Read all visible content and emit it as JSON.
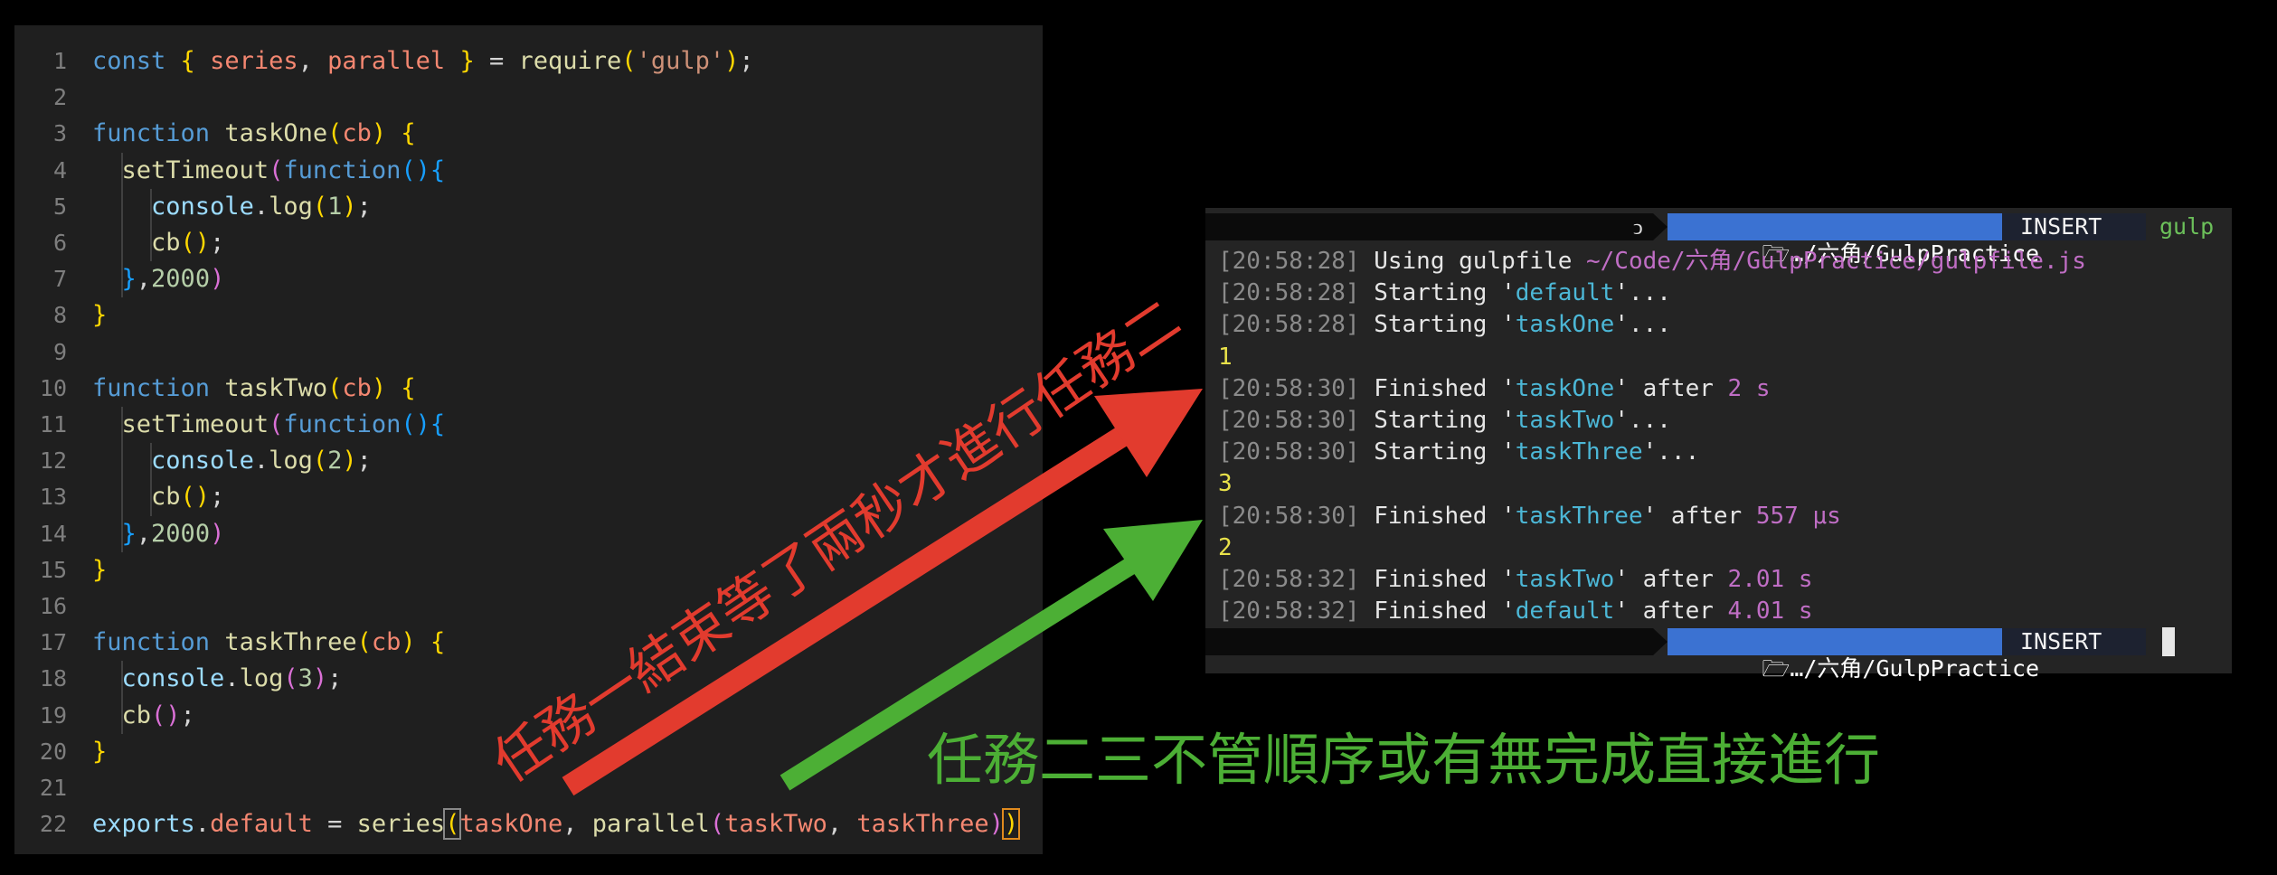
{
  "editor": {
    "lines": [
      {
        "n": "1",
        "html": "<span class='kw2'>const</span> <span class='p1'>{</span> <span class='var'>series</span>, <span class='var'>parallel</span> <span class='p1'>}</span> = <span class='fn'>require</span><span class='p1'>(</span><span class='str'>'gulp'</span><span class='p1'>)</span>;"
      },
      {
        "n": "2",
        "html": ""
      },
      {
        "n": "3",
        "html": "<span class='kw2'>function</span> <span class='fn'>taskOne</span><span class='p1'>(</span><span class='var'>cb</span><span class='p1'>)</span> <span class='p1'>{</span>"
      },
      {
        "n": "4",
        "html": "  <span class='fn'>setTimeout</span><span class='p2'>(</span><span class='kw2'>function</span><span class='p3'>(){</span>"
      },
      {
        "n": "5",
        "html": "    <span class='obj'>console</span>.<span class='fn'>log</span><span class='p1'>(</span><span class='num'>1</span><span class='p1'>)</span>;"
      },
      {
        "n": "6",
        "html": "    <span class='fn'>cb</span><span class='p1'>()</span>;"
      },
      {
        "n": "7",
        "html": "  <span class='p3'>}</span>,<span class='num'>2000</span><span class='p2'>)</span>"
      },
      {
        "n": "8",
        "html": "<span class='p1'>}</span>"
      },
      {
        "n": "9",
        "html": ""
      },
      {
        "n": "10",
        "html": "<span class='kw2'>function</span> <span class='fn'>taskTwo</span><span class='p1'>(</span><span class='var'>cb</span><span class='p1'>)</span> <span class='p1'>{</span>"
      },
      {
        "n": "11",
        "html": "  <span class='fn'>setTimeout</span><span class='p2'>(</span><span class='kw2'>function</span><span class='p3'>(){</span>"
      },
      {
        "n": "12",
        "html": "    <span class='obj'>console</span>.<span class='fn'>log</span><span class='p1'>(</span><span class='num'>2</span><span class='p1'>)</span>;"
      },
      {
        "n": "13",
        "html": "    <span class='fn'>cb</span><span class='p1'>()</span>;"
      },
      {
        "n": "14",
        "html": "  <span class='p3'>}</span>,<span class='num'>2000</span><span class='p2'>)</span>"
      },
      {
        "n": "15",
        "html": "<span class='p1'>}</span>"
      },
      {
        "n": "16",
        "html": ""
      },
      {
        "n": "17",
        "html": "<span class='kw2'>function</span> <span class='fn'>taskThree</span><span class='p1'>(</span><span class='var'>cb</span><span class='p1'>)</span> <span class='p1'>{</span>"
      },
      {
        "n": "18",
        "html": "  <span class='obj'>console</span>.<span class='fn'>log</span><span class='p2'>(</span><span class='num'>3</span><span class='p2'>)</span>;"
      },
      {
        "n": "19",
        "html": "  <span class='fn'>cb</span><span class='p2'>()</span>;"
      },
      {
        "n": "20",
        "html": "<span class='p1'>}</span>"
      },
      {
        "n": "21",
        "html": ""
      },
      {
        "n": "22",
        "html": "<span class='obj'>exports</span>.<span class='var'>default</span> = <span class='fn'>series</span><span class='p1' style='outline:2px solid #888;'>(</span><span class='var'>taskOne</span>, <span class='fn'>parallel</span><span class='p2'>(</span><span class='var'>taskTwo</span>, <span class='var'>taskThree</span><span class='p2'>)</span><span class='p1' style='outline:2px solid #e08a1e;'>)</span>"
      }
    ]
  },
  "terminal": {
    "top_prompt": {
      "path": "…/六角/GulpPractice",
      "mode": "INSERT",
      "cmd": "gulp"
    },
    "bottom_prompt": {
      "path": "…/六角/GulpPractice",
      "mode": "INSERT"
    },
    "lines": [
      {
        "html": "<span class='ts'>[20:58:28]</span> Using gulpfile <span class='path'>~/Code/六角/GulpPractice/gulpfile.js</span>"
      },
      {
        "html": "<span class='ts'>[20:58:28]</span> Starting '<span class='task'>default</span>'..."
      },
      {
        "html": "<span class='ts'>[20:58:28]</span> Starting '<span class='task'>taskOne</span>'..."
      },
      {
        "html": "<span class='num-out'>1</span>"
      },
      {
        "html": "<span class='ts'>[20:58:30]</span> Finished '<span class='task'>taskOne</span>' after <span class='dur'>2 s</span>"
      },
      {
        "html": "<span class='ts'>[20:58:30]</span> Starting '<span class='task'>taskTwo</span>'..."
      },
      {
        "html": "<span class='ts'>[20:58:30]</span> Starting '<span class='task'>taskThree</span>'..."
      },
      {
        "html": "<span class='num-out'>3</span>"
      },
      {
        "html": "<span class='ts'>[20:58:30]</span> Finished '<span class='task'>taskThree</span>' after <span class='dur'>557 μs</span>"
      },
      {
        "html": "<span class='num-out'>2</span>"
      },
      {
        "html": "<span class='ts'>[20:58:32]</span> Finished '<span class='task'>taskTwo</span>' after <span class='dur'>2.01 s</span>"
      },
      {
        "html": "<span class='ts'>[20:58:32]</span> Finished '<span class='task'>default</span>' after <span class='dur'>4.01 s</span>"
      }
    ]
  },
  "annotations": {
    "red_text": "任務一結束等了兩秒才進行任務二",
    "green_text": "任務二三不管順序或有無完成直接進行",
    "red_color": "#e23b2e",
    "green_color": "#4caf35"
  }
}
